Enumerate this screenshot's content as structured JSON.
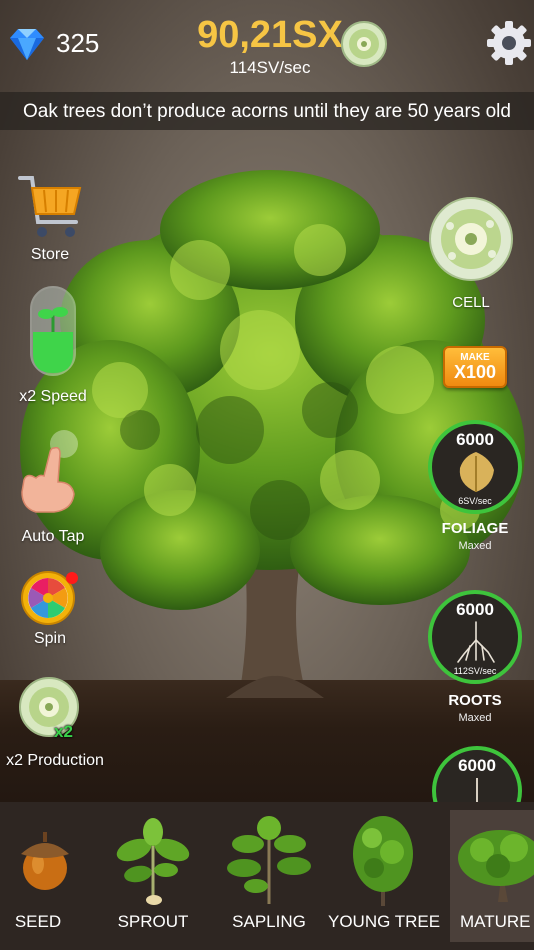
{
  "hud": {
    "gems": "325",
    "money": "90,21SX",
    "rate": "114SV/sec"
  },
  "tip": "Oak trees don’t produce acorns until they are 50 years old",
  "left_menu": [
    {
      "label": "Store",
      "icon": "shopping-cart-icon"
    },
    {
      "label": "x2 Speed",
      "icon": "potion-icon"
    },
    {
      "label": "Auto Tap",
      "icon": "hand-tap-icon"
    },
    {
      "label": "Spin",
      "icon": "wheel-icon"
    },
    {
      "label": "x2 Production",
      "icon": "cell-icon",
      "badge": "x2"
    }
  ],
  "right_panel": {
    "cell_label": "CELL",
    "make_small": "MAKE",
    "make_big": "X100",
    "upgrades": [
      {
        "value": "6000",
        "rate": "6SV/sec",
        "title": "FOLIAGE",
        "sub": "Maxed",
        "icon": "leaf-icon"
      },
      {
        "value": "6000",
        "rate": "112SV/sec",
        "title": "ROOTS",
        "sub": "Maxed",
        "icon": "roots-icon"
      },
      {
        "value": "6000",
        "icon": "stem-icon"
      }
    ]
  },
  "tabs": [
    {
      "label": "SEED",
      "icon": "acorn-icon"
    },
    {
      "label": "SPROUT",
      "icon": "sprout-icon"
    },
    {
      "label": "SAPLING",
      "icon": "sapling-icon"
    },
    {
      "label": "YOUNG TREE",
      "icon": "young-tree-icon"
    },
    {
      "label": "MATURE TR",
      "icon": "mature-tree-icon",
      "selected": true
    }
  ],
  "colors": {
    "money": "#f6c544",
    "ring": "#3ec43c",
    "make_button": "#f39b1a"
  }
}
